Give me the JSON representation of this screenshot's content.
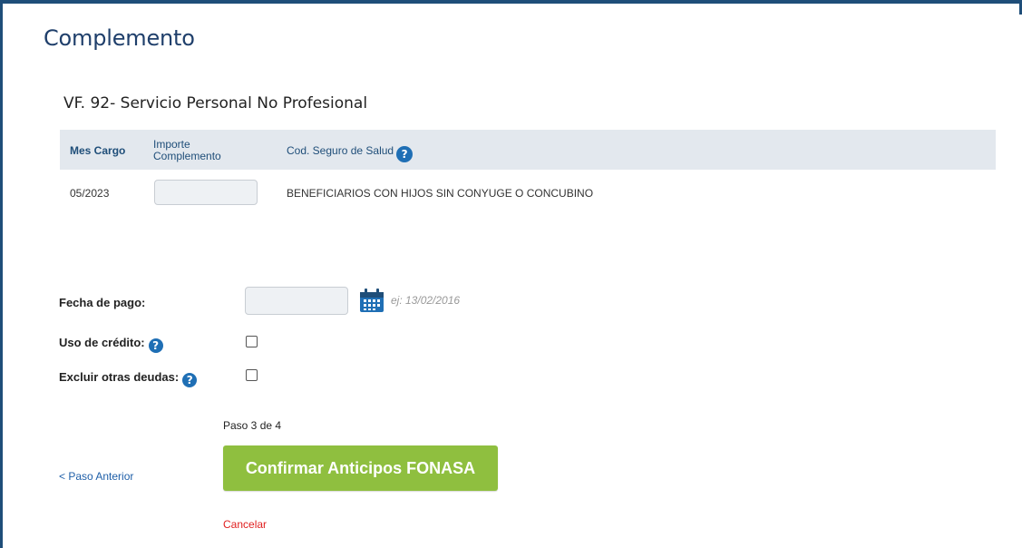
{
  "page": {
    "title": "Complemento"
  },
  "section": {
    "title": "VF. 92- Servicio Personal No Profesional"
  },
  "table": {
    "headers": {
      "mes_cargo": "Mes Cargo",
      "importe_complemento": "Importe Complemento",
      "cod_seguro": "Cod. Seguro de Salud"
    },
    "rows": [
      {
        "mes_cargo": "05/2023",
        "importe_complemento": "",
        "cod_seguro": "BENEFICIARIOS CON HIJOS SIN CONYUGE O CONCUBINO"
      }
    ]
  },
  "form": {
    "fecha_pago": {
      "label": "Fecha de pago:",
      "value": "",
      "hint": "ej: 13/02/2016"
    },
    "uso_credito": {
      "label": "Uso de crédito:",
      "checked": false
    },
    "excluir_deudas": {
      "label": "Excluir otras deudas:",
      "checked": false
    }
  },
  "wizard": {
    "step_text": "Paso 3 de 4",
    "back_label": "< Paso Anterior",
    "confirm_label": "Confirmar Anticipos FONASA",
    "cancel_label": "Cancelar"
  },
  "colors": {
    "frame": "#1f4e79",
    "title": "#1f3f6b",
    "header_bg": "#e3e8ee",
    "button_green": "#8fbf3f",
    "link_blue": "#1f5fa8",
    "cancel_red": "#e02020"
  },
  "icons": {
    "help": "question-circle-icon",
    "calendar": "calendar-icon"
  }
}
